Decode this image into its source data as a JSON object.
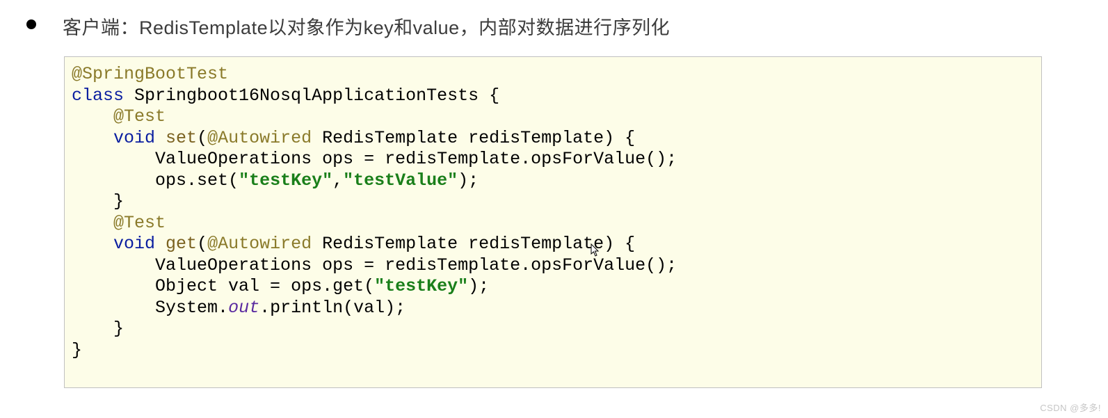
{
  "bullet": "客户端：RedisTemplate以对象作为key和value，内部对数据进行序列化",
  "code": {
    "indent1": "    ",
    "indent2": "        ",
    "ann_springboot": "@SpringBootTest",
    "kw_class": "class",
    "class_decl_rest": " Springboot16NosqlApplicationTests {",
    "ann_test1": "@Test",
    "kw_void1": "void",
    "sp1": " ",
    "m_set": "set",
    "set_open": "(",
    "ann_autowired1": "@Autowired",
    "set_params": " RedisTemplate redisTemplate) {",
    "set_l1": "ValueOperations ops = redisTemplate.opsForValue();",
    "set_l2a": "ops.set(",
    "str_tkey1": "\"testKey\"",
    "set_l2b": ",",
    "str_tval": "\"testValue\"",
    "set_l2c": ");",
    "brace_close1": "}",
    "ann_test2": "@Test",
    "kw_void2": "void",
    "sp2": " ",
    "m_get": "get",
    "get_open": "(",
    "ann_autowired2": "@Autowired",
    "get_params": " RedisTemplate redisTemplate) {",
    "get_l1": "ValueOperations ops = redisTemplate.opsForValue();",
    "get_l2a": "Object val = ops.get(",
    "str_tkey2": "\"testKey\"",
    "get_l2b": ");",
    "get_l3a": "System.",
    "get_out": "out",
    "get_l3b": ".println(val);",
    "brace_close2": "}",
    "brace_close3": "}"
  },
  "watermark": "CSDN @多多!"
}
